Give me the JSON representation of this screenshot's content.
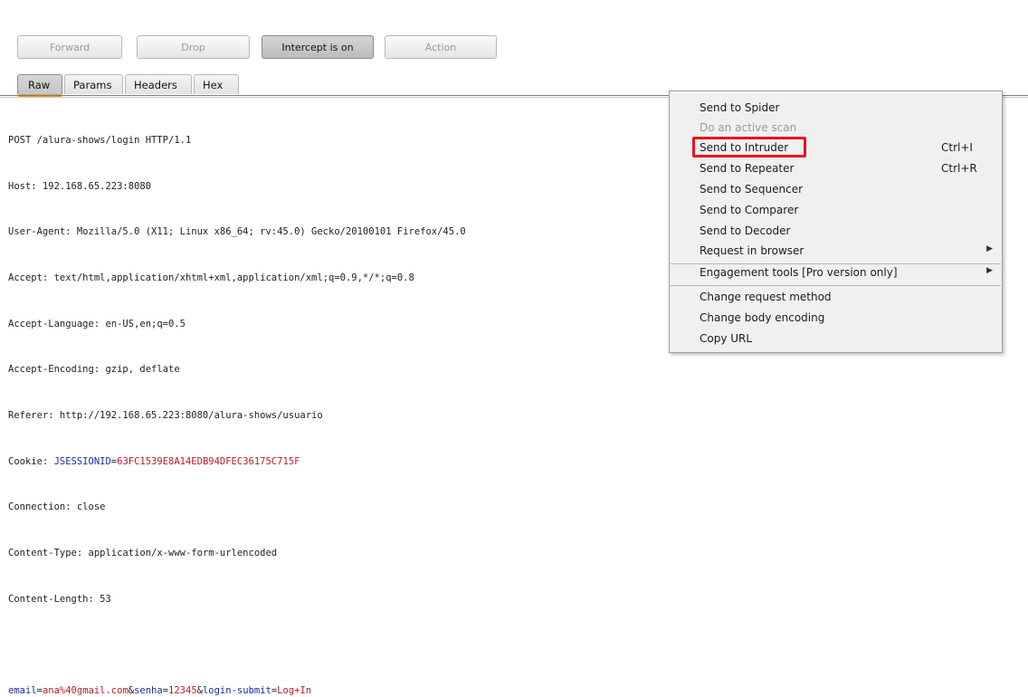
{
  "toolbar": {
    "forward_label": "Forward",
    "drop_label": "Drop",
    "intercept_label": "Intercept is on",
    "action_label": "Action"
  },
  "tabs": [
    "Raw",
    "Params",
    "Headers",
    "Hex"
  ],
  "active_tab": "Raw",
  "request": {
    "request_line": "POST /alura-shows/login HTTP/1.1",
    "host": "Host: 192.168.65.223:8080",
    "user_agent": "User-Agent: Mozilla/5.0 (X11; Linux x86_64; rv:45.0) Gecko/20100101 Firefox/45.0",
    "accept": "Accept: text/html,application/xhtml+xml,application/xml;q=0.9,*/*;q=0.8",
    "accept_language": "Accept-Language: en-US,en;q=0.5",
    "accept_encoding": "Accept-Encoding: gzip, deflate",
    "referer": "Referer: http://192.168.65.223:8080/alura-shows/usuario",
    "cookie_prefix": "Cookie: ",
    "cookie_name": "JSESSIONID",
    "cookie_eq": "=",
    "cookie_value": "63FC1539E8A14EDB94DFEC36175C715F",
    "connection": "Connection: close",
    "content_type": "Content-Type: application/x-www-form-urlencoded",
    "content_length": "Content-Length: 53",
    "body": [
      {
        "k": "email",
        "v": "ana%40gmail.com"
      },
      {
        "k": "senha",
        "v": "12345"
      },
      {
        "k": "login-submit",
        "v": "Log+In"
      }
    ]
  },
  "context_menu": {
    "items": [
      {
        "label": "Send to Spider"
      },
      {
        "label": "Do an active scan"
      },
      {
        "label": "Send to Intruder",
        "shortcut": "Ctrl+I"
      },
      {
        "label": "Send to Repeater",
        "shortcut": "Ctrl+R"
      },
      {
        "label": "Send to Sequencer"
      },
      {
        "label": "Send to Comparer"
      },
      {
        "label": "Send to Decoder"
      },
      {
        "label": "Request in browser"
      },
      {
        "label": "Engagement tools [Pro version only]"
      },
      {
        "label": "Change request method"
      },
      {
        "label": "Change body encoding"
      },
      {
        "label": "Copy URL"
      }
    ],
    "highlighted_item": "Send to Intruder",
    "highlight_color": "#e8141e"
  }
}
